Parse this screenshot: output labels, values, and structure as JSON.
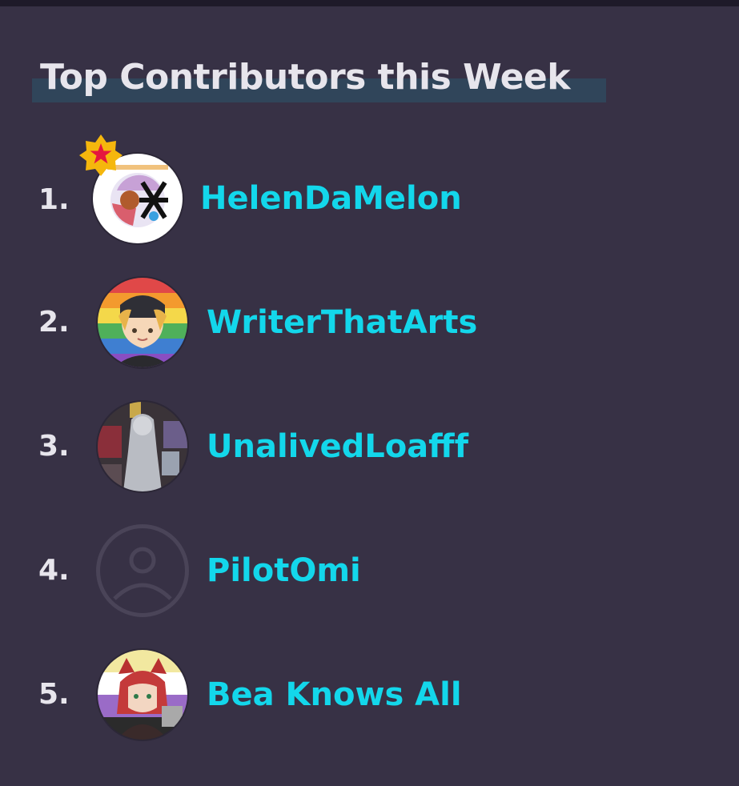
{
  "header": {
    "title": "Top Contributors this Week"
  },
  "contributors": [
    {
      "rank": "1.",
      "name": "HelenDaMelon",
      "avatar_icon": "stamp-avatar-icon",
      "top_badge": "star-badge-icon"
    },
    {
      "rank": "2.",
      "name": "WriterThatArts",
      "avatar_icon": "rainbow-portrait-avatar-icon"
    },
    {
      "rank": "3.",
      "name": "UnalivedLoafff",
      "avatar_icon": "gray-figure-avatar-icon"
    },
    {
      "rank": "4.",
      "name": "PilotOmi",
      "avatar_icon": "default-user-icon"
    },
    {
      "rank": "5.",
      "name": "Bea Knows All",
      "avatar_icon": "red-hair-portrait-avatar-icon"
    }
  ],
  "colors": {
    "background": "#373145",
    "name": "#13d7eb",
    "rank": "#e7e5ec",
    "badge": "#f5b70d",
    "badge_star": "#e5163f"
  }
}
